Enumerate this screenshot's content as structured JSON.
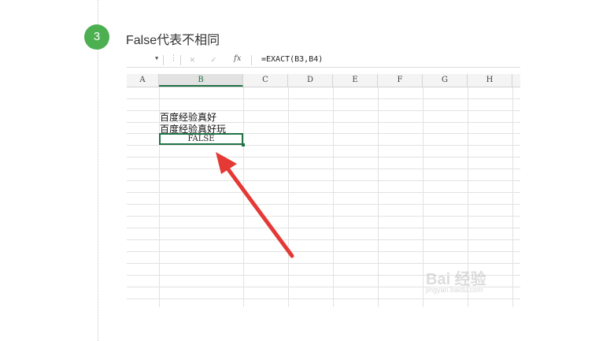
{
  "step": {
    "number": "3",
    "title": "False代表不相同",
    "accent_color": "#4caf50"
  },
  "formula_bar": {
    "dropdown_icon": "chevron-down-icon",
    "cancel_icon": "close-icon",
    "enter_icon": "check-icon",
    "function_label": "fx",
    "formula": "=EXACT(B3,B4)"
  },
  "sheet": {
    "columns": [
      "A",
      "B",
      "C",
      "D",
      "E",
      "F",
      "G",
      "H"
    ],
    "selected_column": "B",
    "cells": {
      "B3": "百度经验真好",
      "B4": "百度经验真好玩",
      "B5": "FALSE"
    },
    "grid_color": "#217346"
  },
  "annotation": {
    "arrow_color": "#e53935"
  },
  "watermark": {
    "text": "Bai 经验",
    "sub": "jingyan.baidu.com"
  }
}
